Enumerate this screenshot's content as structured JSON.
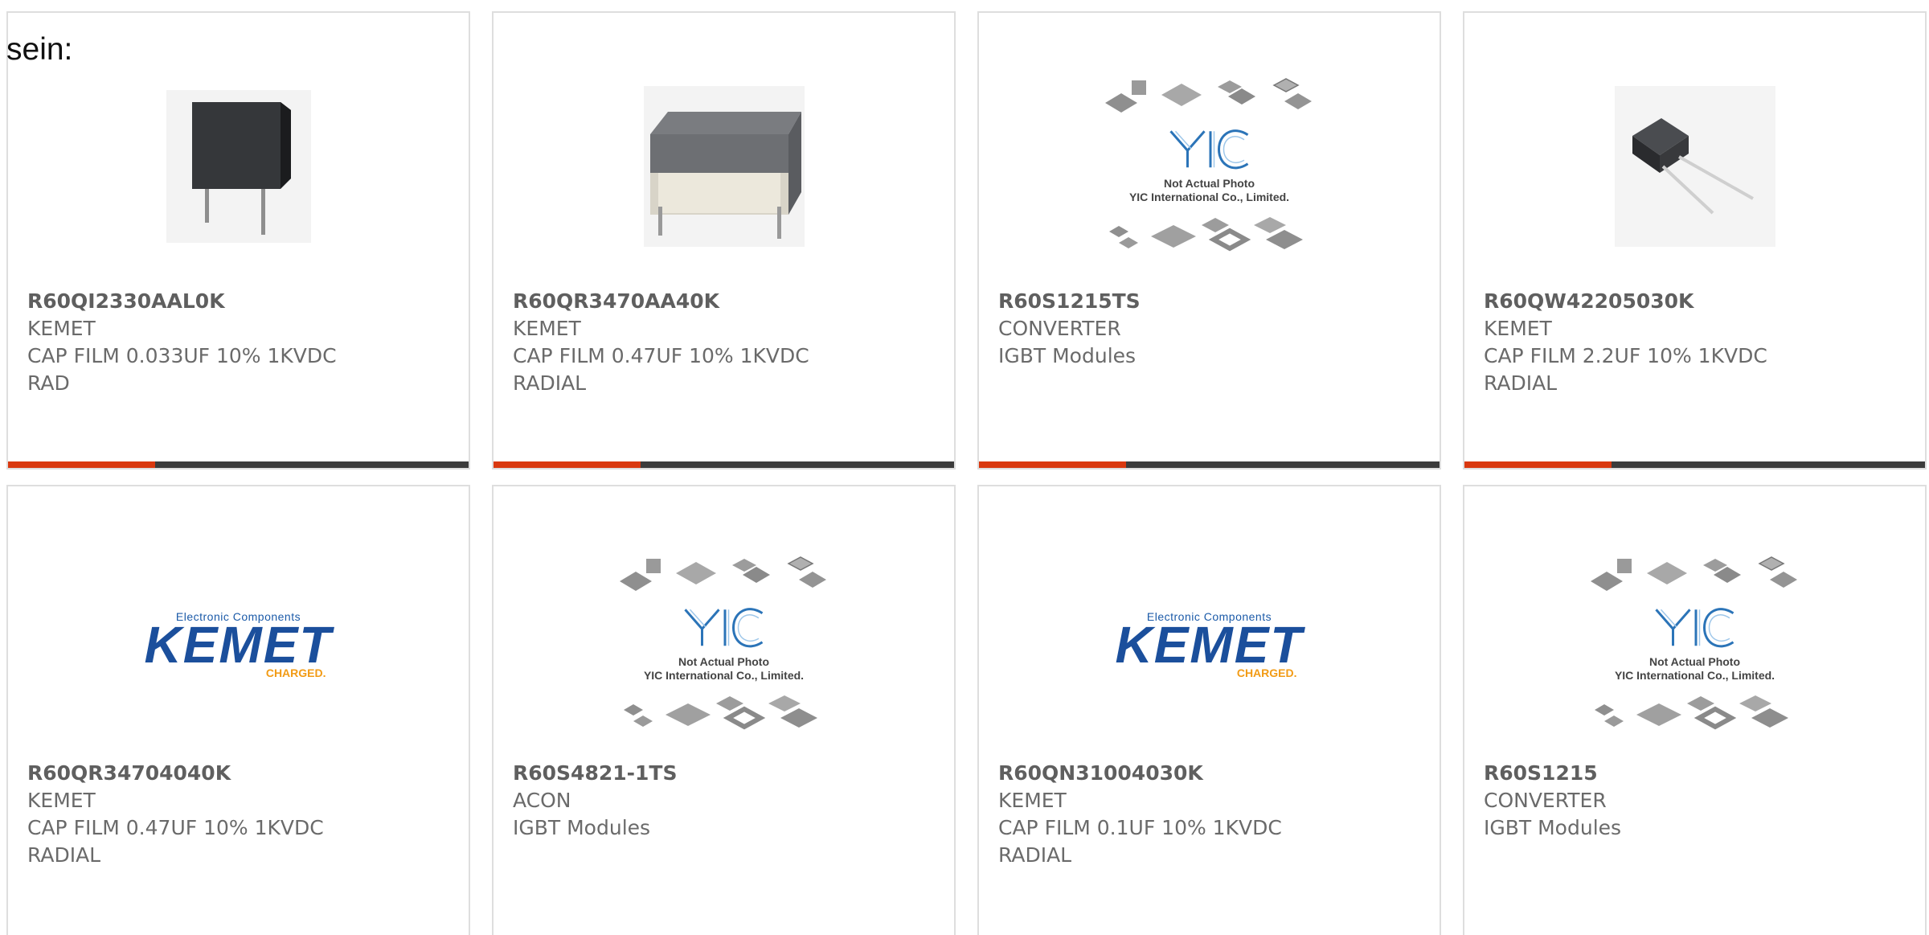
{
  "prefix": "sein:",
  "accent_color": "#d9380f",
  "products": [
    {
      "part": "R60QI2330AAL0K",
      "maker": "KEMET",
      "desc1": "CAP FILM 0.033UF 10% 1KVDC",
      "desc2": "RAD",
      "image": "capacitor-black-photo"
    },
    {
      "part": "R60QR3470AA40K",
      "maker": "KEMET",
      "desc1": "CAP FILM 0.47UF 10% 1KVDC",
      "desc2": "RADIAL",
      "image": "capacitor-gray-photo"
    },
    {
      "part": "R60S1215TS",
      "maker": "CONVERTER",
      "desc1": "IGBT Modules",
      "desc2": "",
      "image": "yic-placeholder"
    },
    {
      "part": "R60QW42205030K",
      "maker": "KEMET",
      "desc1": "CAP FILM 2.2UF 10% 1KVDC",
      "desc2": "RADIAL",
      "image": "capacitor-small-photo"
    },
    {
      "part": "R60QR34704040K",
      "maker": "KEMET",
      "desc1": "CAP FILM 0.47UF 10% 1KVDC",
      "desc2": "RADIAL",
      "image": "kemet-logo"
    },
    {
      "part": "R60S4821-1TS",
      "maker": "ACON",
      "desc1": "IGBT Modules",
      "desc2": "",
      "image": "yic-placeholder"
    },
    {
      "part": "R60QN31004030K",
      "maker": "KEMET",
      "desc1": "CAP FILM 0.1UF 10% 1KVDC",
      "desc2": "RADIAL",
      "image": "kemet-logo"
    },
    {
      "part": "R60S1215",
      "maker": "CONVERTER",
      "desc1": "IGBT Modules",
      "desc2": "",
      "image": "yic-placeholder"
    }
  ],
  "kemet_logo": {
    "top": "Electronic Components",
    "brand": "KEMET",
    "tag": "CHARGED."
  },
  "yic_placeholder": {
    "brand": "YIC",
    "line1": "Not Actual Photo",
    "line2": "YIC International Co., Limited."
  }
}
